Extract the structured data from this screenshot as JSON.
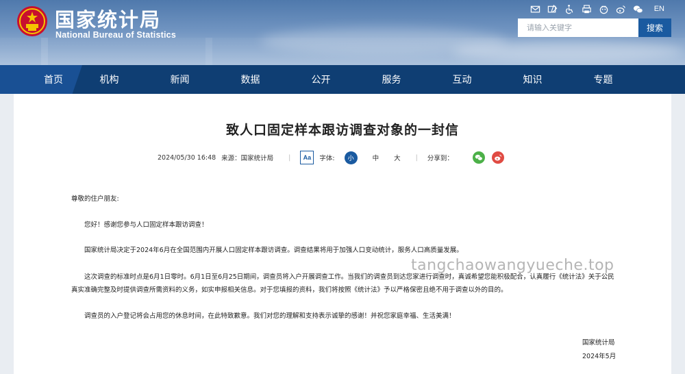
{
  "header": {
    "title_cn": "国家统计局",
    "title_en": "National Bureau of Statistics",
    "lang_switch": "EN",
    "search": {
      "placeholder": "请输入关键字",
      "button": "搜索"
    },
    "tool_icons": [
      "mail-icon",
      "feedback-icon",
      "accessibility-icon",
      "print-icon",
      "app-icon",
      "weibo-icon",
      "wechat-icon"
    ]
  },
  "nav": {
    "items": [
      "首页",
      "机构",
      "新闻",
      "数据",
      "公开",
      "服务",
      "互动",
      "知识",
      "专题"
    ]
  },
  "article": {
    "title": "致人口固定样本跟访调查对象的一封信",
    "date": "2024/05/30 16:48",
    "source": "来源：国家统计局",
    "font_label": "字体:",
    "font_sizes": {
      "small": "小",
      "medium": "中",
      "large": "大"
    },
    "font_toggle": "Aa",
    "share_label": "分享到：",
    "greeting": "尊敬的住户朋友:",
    "paragraphs": [
      "您好！感谢您参与人口固定样本跟访调查！",
      "国家统计局决定于2024年6月在全国范围内开展人口固定样本跟访调查。调查结果将用于加强人口变动统计，服务人口高质量发展。",
      "这次调查的标准时点是6月1日零时。6月1日至6月25日期间，调查员将入户开展调查工作。当我们的调查员到达您家进行调查时，真诚希望您能积极配合，认真履行《统计法》关于公民真实准确完整及时提供调查所需资料的义务，如实申报相关信息。对于您填报的资料，我们将按照《统计法》予以严格保密且绝不用于调查以外的目的。",
      "调查员的入户登记将会占用您的休息时间，在此特致歉意。我们对您的理解和支持表示诚挚的感谢！并祝您家庭幸福、生活美满！"
    ],
    "signature_org": "国家统计局",
    "signature_date": "2024年5月"
  },
  "watermark": "tangchaowangyueche.top",
  "colors": {
    "nav_bg": "#0f3e73",
    "accent": "#1a5aa0",
    "wechat": "#4cb048",
    "weibo": "#e04b43"
  }
}
